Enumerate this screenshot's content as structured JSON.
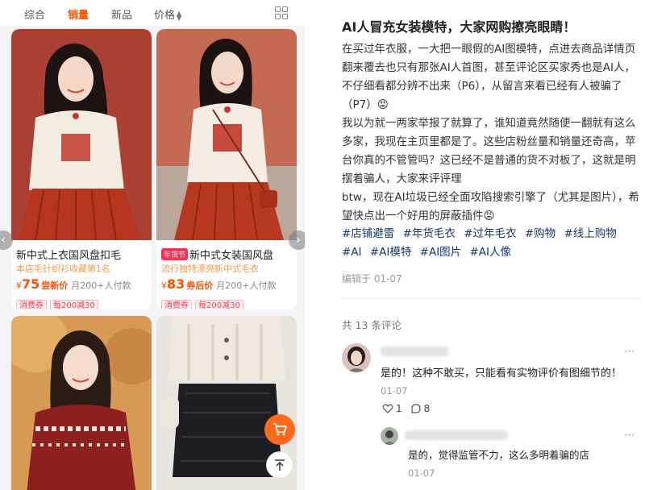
{
  "filters": [
    "综合",
    "销量",
    "新品",
    "价格"
  ],
  "active_filter": "销量",
  "products": [
    {
      "title": "新中式上衣国风盘扣毛",
      "badge": "",
      "subtitle": "本店毛针织衫收藏第1名",
      "currency": "¥",
      "price": "75",
      "price_note": "尝新价",
      "sold": "月200+人付款",
      "coupons": [
        "消费券",
        "每200减30"
      ]
    },
    {
      "title": "新中式女装国风盘",
      "badge": "年货节",
      "subtitle": "流行独特漂亮新中式毛衣",
      "currency": "¥",
      "price": "83",
      "price_note": "券后价",
      "sold": "月200+人付款",
      "coupons": [
        "消费券",
        "每200减30"
      ]
    }
  ],
  "post": {
    "title": "AI人冒充女装模特，大家网购擦亮眼睛！",
    "paragraphs": [
      "在买过年衣服，一大把一眼假的AI图模特，点进去商品详情页翻来覆去也只有那张AI人首图，甚至评论区买家秀也是AI人，不仔细看都分辨不出来（P6），从留言来看已经有人被骗了（P7）😡",
      "我以为就一两家举报了就算了，谁知道竟然随便一翻就有这么多家，我现在主页里都是了。这些店粉丝量和销量还奇高，苹台你真的不管管吗？这已经不是普通的货不对板了，这就是明摆着骗人，大家来评评理",
      "btw，现在AI垃圾已经全面攻陷搜索引擎了（尤其是图片），希望快点出一个好用的屏蔽插件😡"
    ],
    "hashtags": [
      "#店铺避雷",
      "#年货毛衣",
      "#过年毛衣",
      "#购物",
      "#线上购物",
      "#AI",
      "#AI模特",
      "#AI图片",
      "#AI人像"
    ],
    "edited": "编辑于 01-07"
  },
  "comments": {
    "count_text": "共 13 条评论",
    "items": [
      {
        "text": "是的！这种不敢买，只能看有实物评价有图细节的！",
        "time": "01-07",
        "likes": "1",
        "replies": "8"
      }
    ],
    "reply": {
      "text": "是的，觉得监管不力，这么多明着骗的店",
      "time": "01-07"
    }
  },
  "colors": {
    "accent": "#ff5000",
    "hashtag": "#13386c"
  },
  "icons": [
    "grid-view-icon",
    "chevron-left-icon",
    "chevron-right-icon",
    "cart-icon",
    "back-to-top-icon",
    "heart-icon",
    "comment-icon",
    "more-icon"
  ]
}
